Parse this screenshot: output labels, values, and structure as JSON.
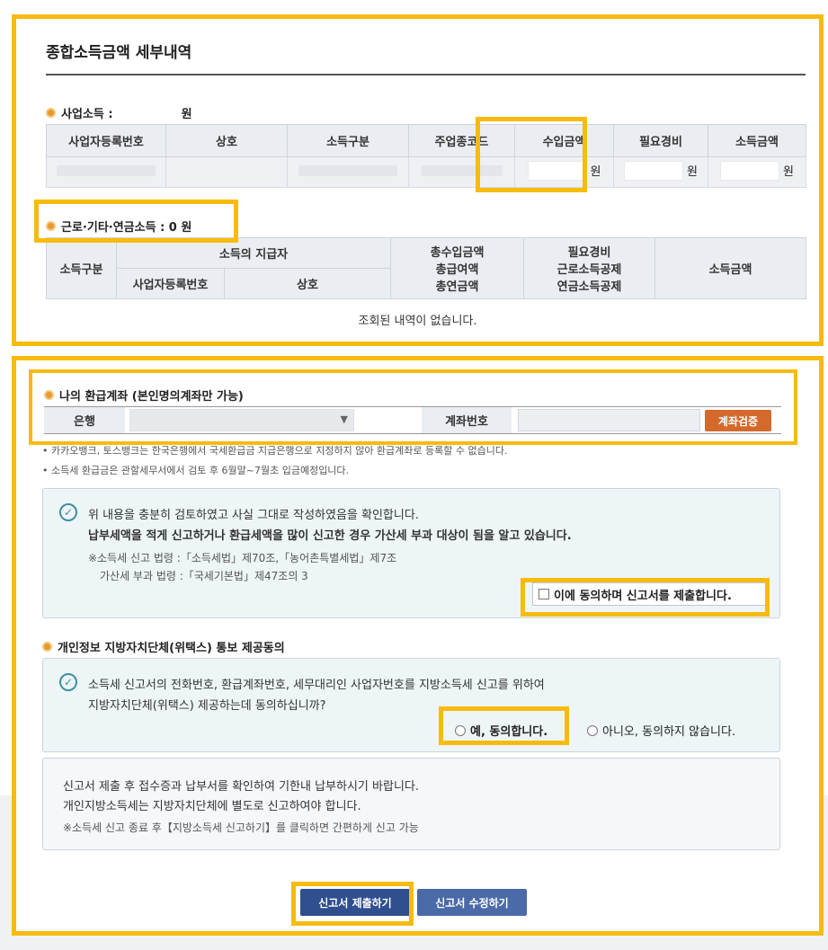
{
  "summary": {
    "title": "종합소득금액 세부내역",
    "business": {
      "label": "사업소득 :",
      "unit": "원",
      "headers": [
        "사업자등록번호",
        "상호",
        "소득구분",
        "주업종코드",
        "수입금액",
        "필요경비",
        "소득금액"
      ],
      "won": "원"
    },
    "wage": {
      "label": "근로·기타·연금소득 : 0 원",
      "h_income_type": "소득구분",
      "h_payer": "소득의 지급자",
      "h_bizno": "사업자등록번호",
      "h_name": "상호",
      "h_total_line1": "총수입금액",
      "h_total_line2": "총급여액",
      "h_total_line3": "총연금액",
      "h_exp_line1": "필요경비",
      "h_exp_line2": "근로소득공제",
      "h_exp_line3": "연금소득공제",
      "h_income": "소득금액",
      "empty": "조회된 내역이 없습니다."
    }
  },
  "refund": {
    "label": "나의 환급계좌 (본인명의계좌만 가능)",
    "bank_label": "은행",
    "account_label": "계좌번호",
    "verify_button": "계좌검증",
    "note1": "카카오뱅크, 토스뱅크는 한국은행에서 국세환급금 지급은행으로 지정하지 않아 환급계좌로 등록할 수 없습니다.",
    "note2": "소득세 환급금은 관할세무서에서 검토 후 6월말~7월초 입금예정입니다."
  },
  "confirm": {
    "line1": "위 내용을 충분히 검토하였고 사실 그대로 작성하였음을 확인합니다.",
    "line2": "납부세액을 적게 신고하거나 환급세액을 많이 신고한 경우 가산세 부과 대상이 됨을 알고 있습니다.",
    "law1": "※소득세 신고 법령 :「소득세법」제70조,「농어촌특별세법」제7조",
    "law2": "가산세 부과 법령 :「국세기본법」제47조의 3",
    "agree": "이에 동의하며 신고서를 제출합니다."
  },
  "privacy": {
    "label": "개인정보 지방자치단체(위택스) 통보 제공동의",
    "line1": "소득세 신고서의 전화번호, 환급계좌번호, 세무대리인 사업자번호를 지방소득세 신고를 위하여",
    "line2": "지방자치단체(위택스) 제공하는데 동의하십니까?",
    "yes": "예, 동의합니다.",
    "no": "아니오, 동의하지 않습니다."
  },
  "notice": {
    "line1": "신고서 제출 후 접수증과 납부서를 확인하여 기한내 납부하시기 바랍니다.",
    "line2": "개인지방소득세는 지방자치단체에 별도로 신고하여야 합니다.",
    "line3": "※소득세 신고 종료 후【지방소득세 신고하기】를 클릭하면 간편하게 신고 가능"
  },
  "actions": {
    "submit": "신고서 제출하기",
    "edit": "신고서 수정하기"
  },
  "colors": {
    "highlight": "#f7bb0f",
    "verify": "#d4692c",
    "primary": "#2f4f8f",
    "accent_dot": "#e59a2c"
  }
}
